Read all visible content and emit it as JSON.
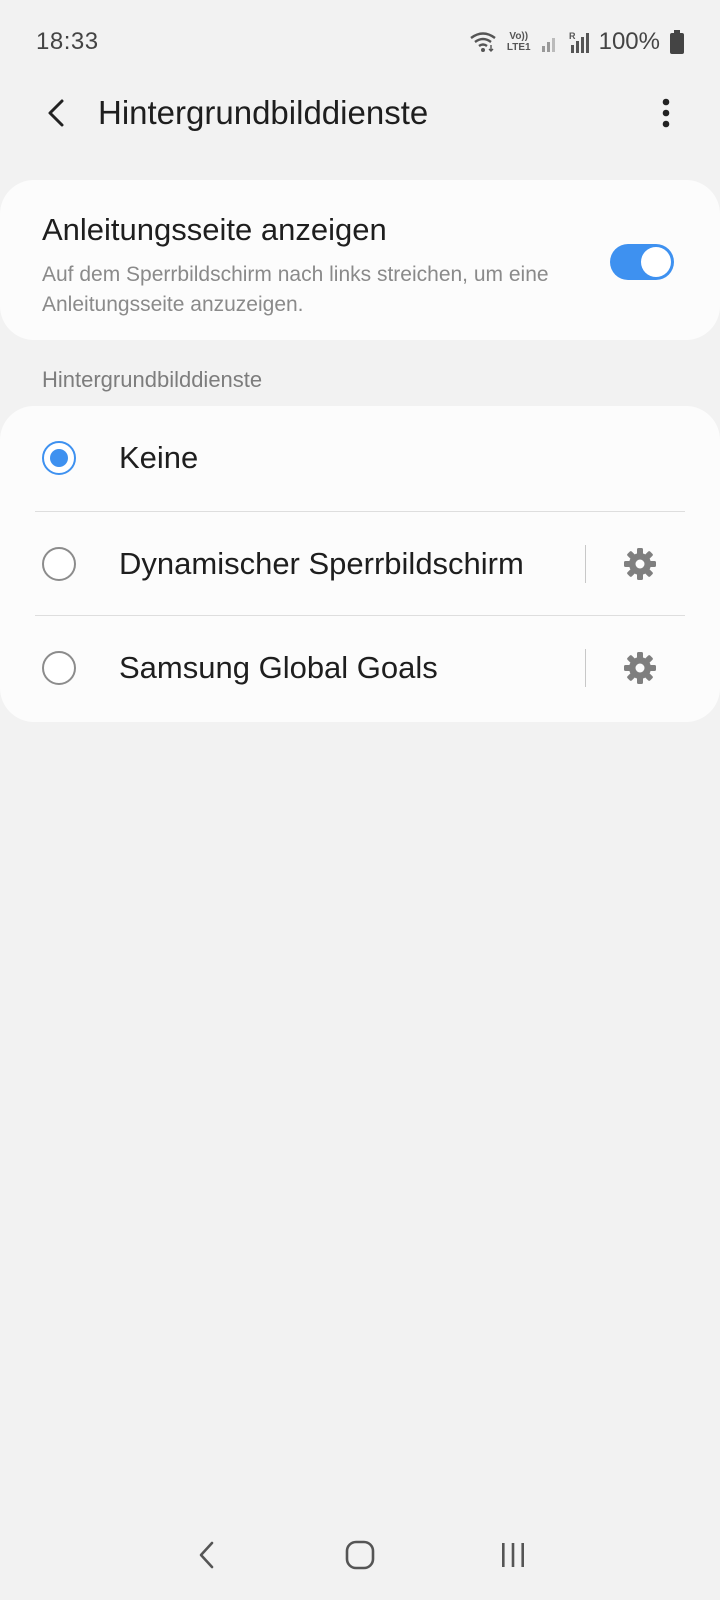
{
  "status_bar": {
    "time": "18:33",
    "battery": "100%",
    "lte_top": "Vo))",
    "lte_bottom": "LTE1",
    "icons": [
      "wifi-icon",
      "signal-icon",
      "signal-roaming-icon",
      "battery-icon"
    ]
  },
  "app_bar": {
    "title": "Hintergrundbilddienste",
    "back_icon": "back-arrow-icon",
    "more_icon": "more-vert-icon"
  },
  "guide_setting": {
    "title": "Anleitungsseite anzeigen",
    "description": "Auf dem Sperrbildschirm nach links streichen, um eine Anleitungsseite anzuzeigen.",
    "enabled": true
  },
  "section": {
    "header": "Hintergrundbilddienste"
  },
  "options": [
    {
      "label": "Keine",
      "selected": true,
      "has_settings": false
    },
    {
      "label": "Dynamischer Sperrbildschirm",
      "selected": false,
      "has_settings": true
    },
    {
      "label": "Samsung Global Goals",
      "selected": false,
      "has_settings": true
    }
  ],
  "nav_bar": {
    "icons": [
      "nav-back-icon",
      "nav-home-icon",
      "nav-recents-icon"
    ]
  },
  "colors": {
    "accent": "#3e91f0",
    "background": "#f2f2f2",
    "card": "#fcfcfc"
  }
}
